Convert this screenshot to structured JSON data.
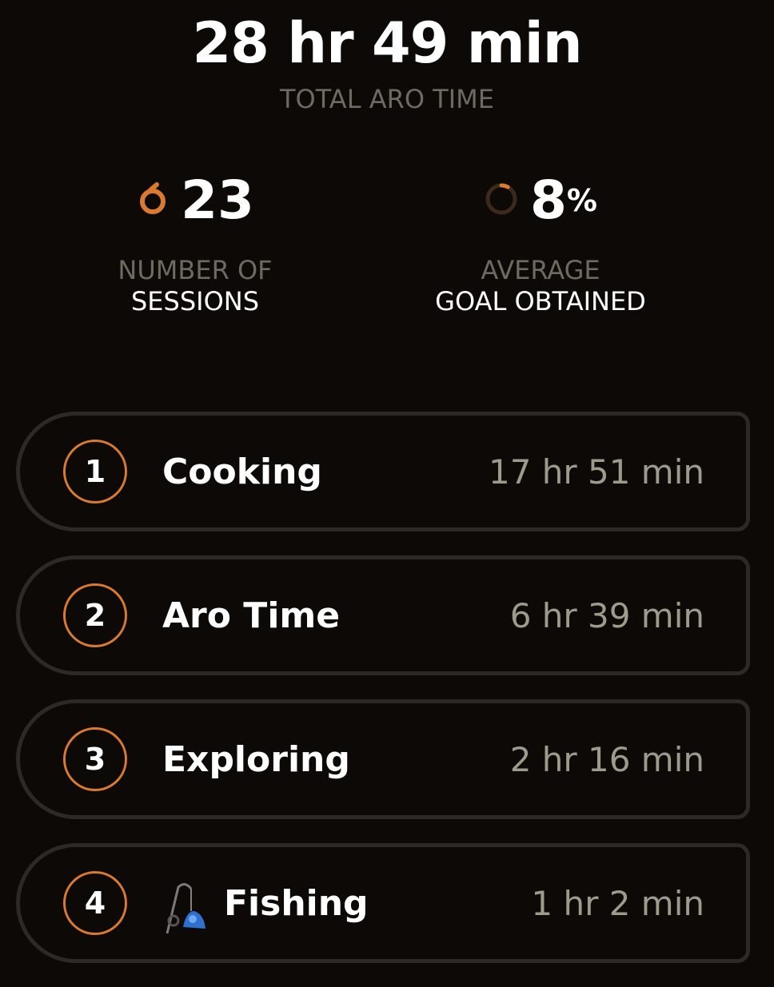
{
  "summary": {
    "total_time": "28 hr 49 min",
    "total_label": "TOTAL ARO TIME"
  },
  "stats": {
    "sessions": {
      "value": "23",
      "label_top": "NUMBER OF",
      "label_bottom": "SESSIONS",
      "icon": "ring-icon"
    },
    "goal": {
      "value": "8",
      "unit": "%",
      "label_top": "AVERAGE",
      "label_bottom": "GOAL OBTAINED",
      "icon": "goal-progress-ring-icon",
      "progress_fraction": 0.08
    }
  },
  "activities": [
    {
      "rank": "1",
      "name": "Cooking",
      "duration": "17 hr 51 min"
    },
    {
      "rank": "2",
      "name": "Aro Time",
      "duration": "6 hr 39 min"
    },
    {
      "rank": "3",
      "name": "Exploring",
      "duration": "2 hr 16 min"
    },
    {
      "rank": "4",
      "name": "Fishing",
      "duration": "1 hr 2 min",
      "icon": "fishing-rod-icon"
    }
  ],
  "colors": {
    "background": "#0c0907",
    "accent": "#d97a2f",
    "muted_text": "#6d6b61",
    "duration_text": "#9e9b8d",
    "row_border": "#2b2a26"
  }
}
